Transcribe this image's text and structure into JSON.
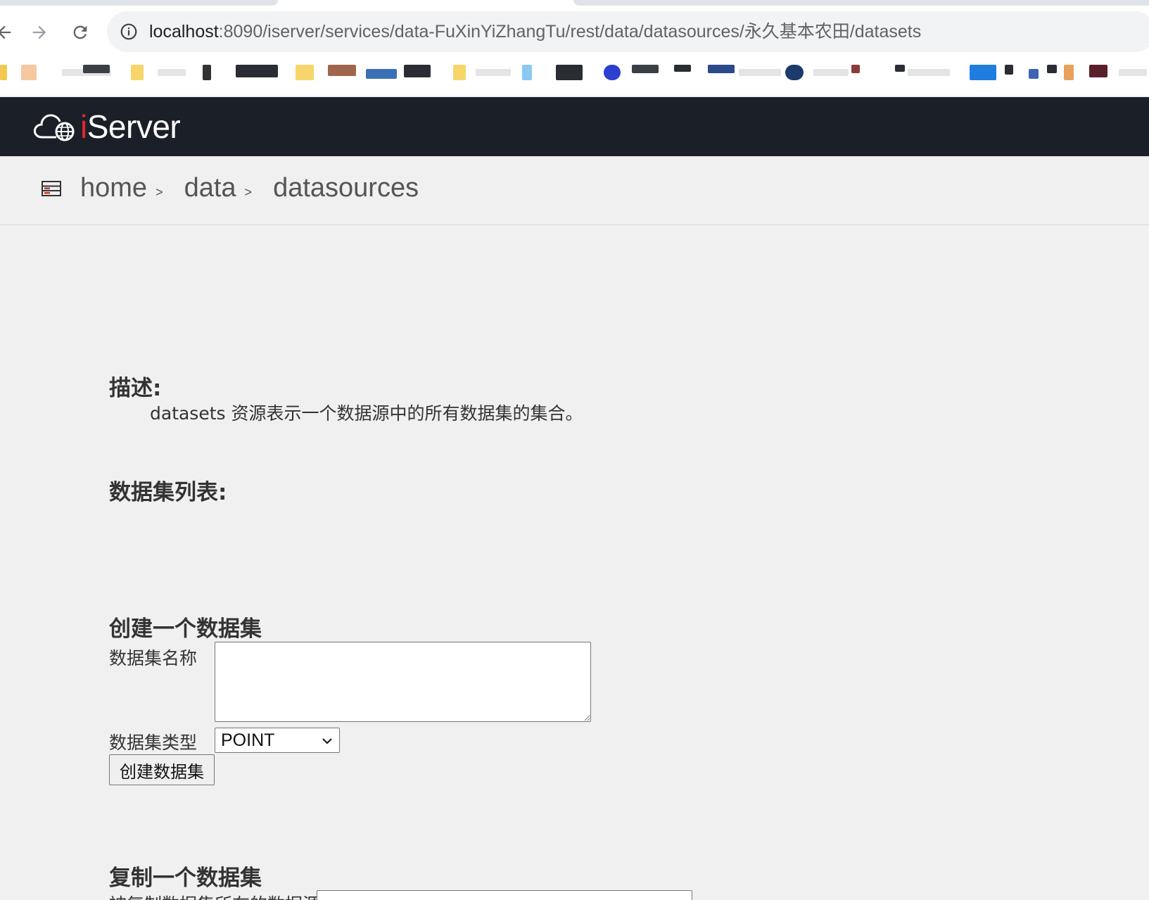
{
  "browser": {
    "url_host": "localhost",
    "url_rest": ":8090/iserver/services/data-FuXinYiZhangTu/rest/data/datasources/永久基本农田/datasets"
  },
  "app": {
    "logo_text_i": "i",
    "logo_text_rest": "Server"
  },
  "breadcrumb": {
    "items": [
      {
        "label": "home"
      },
      {
        "label": "data"
      }
    ],
    "separator": ">",
    "current": "datasources"
  },
  "description": {
    "title": "描述:",
    "text": "datasets 资源表示一个数据源中的所有数据集的集合。"
  },
  "dataset_list": {
    "title": "数据集列表:"
  },
  "create_dataset": {
    "title": "创建一个数据集",
    "name_label": "数据集名称",
    "name_value": "",
    "type_label": "数据集类型",
    "type_selected": "POINT",
    "submit_label": "创建数据集"
  },
  "copy_dataset": {
    "title": "复制一个数据集",
    "source_label": "被复制数据集所在的数据源"
  },
  "colors": {
    "header_bg": "#1b1f28",
    "logo_accent": "#e3252e",
    "page_bg": "#f0f0f0"
  }
}
